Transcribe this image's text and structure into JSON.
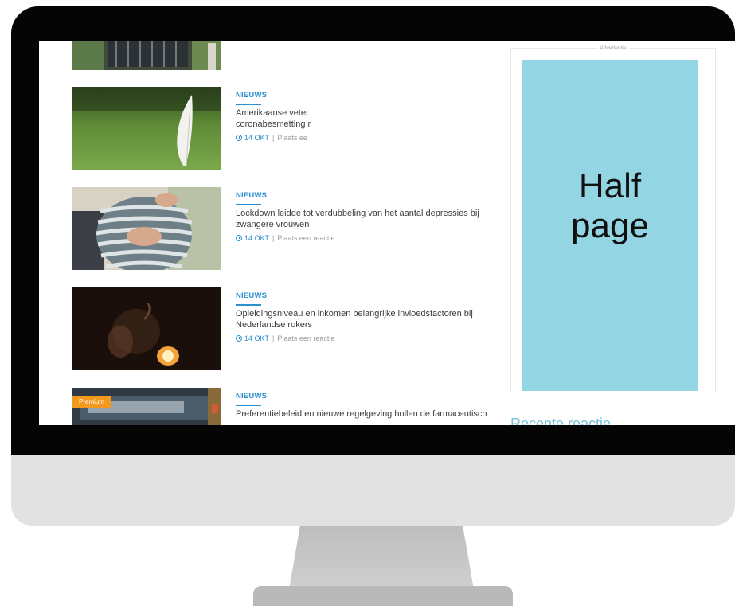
{
  "articles": [
    {
      "category": "NIEUWS",
      "title": "Amerikaanse veter\ncoronabesmetting r",
      "date": "14 OKT",
      "reaction": "Plaats ee",
      "thumb": "feather-on-grass"
    },
    {
      "category": "NIEUWS",
      "title": "Lockdown leidde tot verdubbeling van het aantal depressies bij zwangere vrouwen",
      "date": "14 OKT",
      "reaction": "Plaats een reactie",
      "thumb": "pregnant-belly"
    },
    {
      "category": "NIEUWS",
      "title": "Opleidingsniveau en inkomen belangrijke invloedsfactoren bij Nederlandse rokers",
      "date": "14 OKT",
      "reaction": "Plaats een reactie",
      "thumb": "smoker-dark"
    },
    {
      "category": "NIEUWS",
      "title": "Preferentiebeleid en nieuwe regelgeving hollen de farmaceutisch",
      "date": "",
      "reaction": "",
      "thumb": "pharmacy-storefront",
      "badge": "Premium"
    }
  ],
  "sidebar": {
    "ad_label": "Advertentie",
    "ad_text": "Half\npage",
    "ad_color": "#94d5e4",
    "recent_heading": "Recente reactie"
  },
  "colors": {
    "accent": "#2a8fcf",
    "premium": "#f39a1e"
  }
}
